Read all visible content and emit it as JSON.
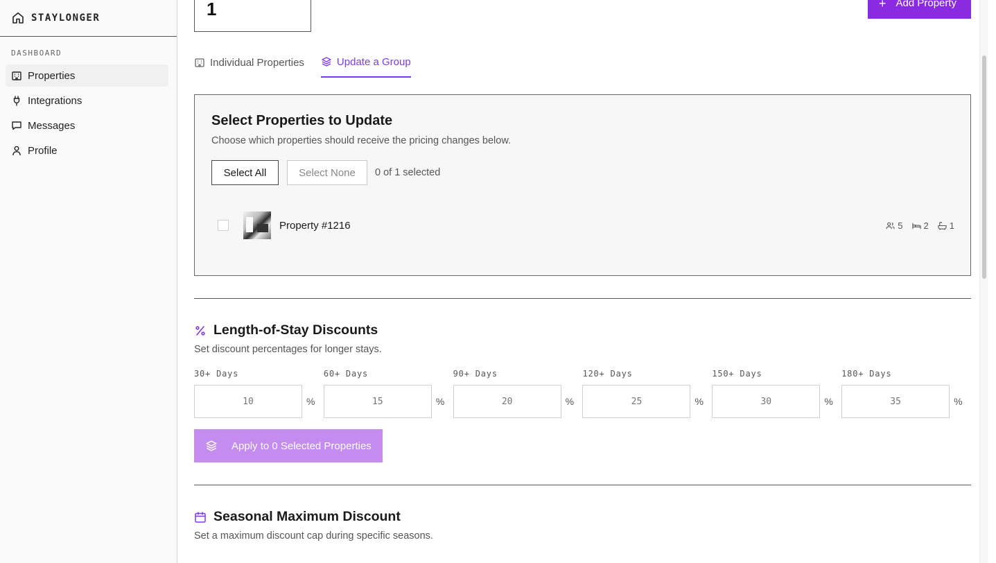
{
  "sidebar": {
    "brand": "STAYLONGER",
    "section_label": "DASHBOARD",
    "items": [
      {
        "label": "Properties"
      },
      {
        "label": "Integrations"
      },
      {
        "label": "Messages"
      },
      {
        "label": "Profile"
      }
    ]
  },
  "header": {
    "count_value": "1",
    "add_button": "Add Property"
  },
  "tabs": [
    {
      "label": "Individual Properties"
    },
    {
      "label": "Update a Group"
    }
  ],
  "select_card": {
    "title": "Select Properties to Update",
    "subtitle": "Choose which properties should receive the pricing changes below.",
    "select_all": "Select All",
    "select_none": "Select None",
    "selected_count": "0 of 1 selected",
    "property": {
      "name": "Property #1216",
      "guests": "5",
      "bedrooms": "2",
      "bathrooms": "1"
    }
  },
  "los": {
    "title": "Length-of-Stay Discounts",
    "subtitle": "Set discount percentages for longer stays.",
    "fields": [
      {
        "label": "30+ Days",
        "placeholder": "10",
        "unit": "%"
      },
      {
        "label": "60+ Days",
        "placeholder": "15",
        "unit": "%"
      },
      {
        "label": "90+ Days",
        "placeholder": "20",
        "unit": "%"
      },
      {
        "label": "120+ Days",
        "placeholder": "25",
        "unit": "%"
      },
      {
        "label": "150+ Days",
        "placeholder": "30",
        "unit": "%"
      },
      {
        "label": "180+ Days",
        "placeholder": "35",
        "unit": "%"
      }
    ],
    "apply_button": "Apply to 0 Selected Properties"
  },
  "seasonal": {
    "title": "Seasonal Maximum Discount",
    "subtitle": "Set a maximum discount cap during specific seasons."
  },
  "colors": {
    "accent": "#8a2be2",
    "accent_light": "#c58cf0",
    "tab_active": "#7c3aed"
  }
}
